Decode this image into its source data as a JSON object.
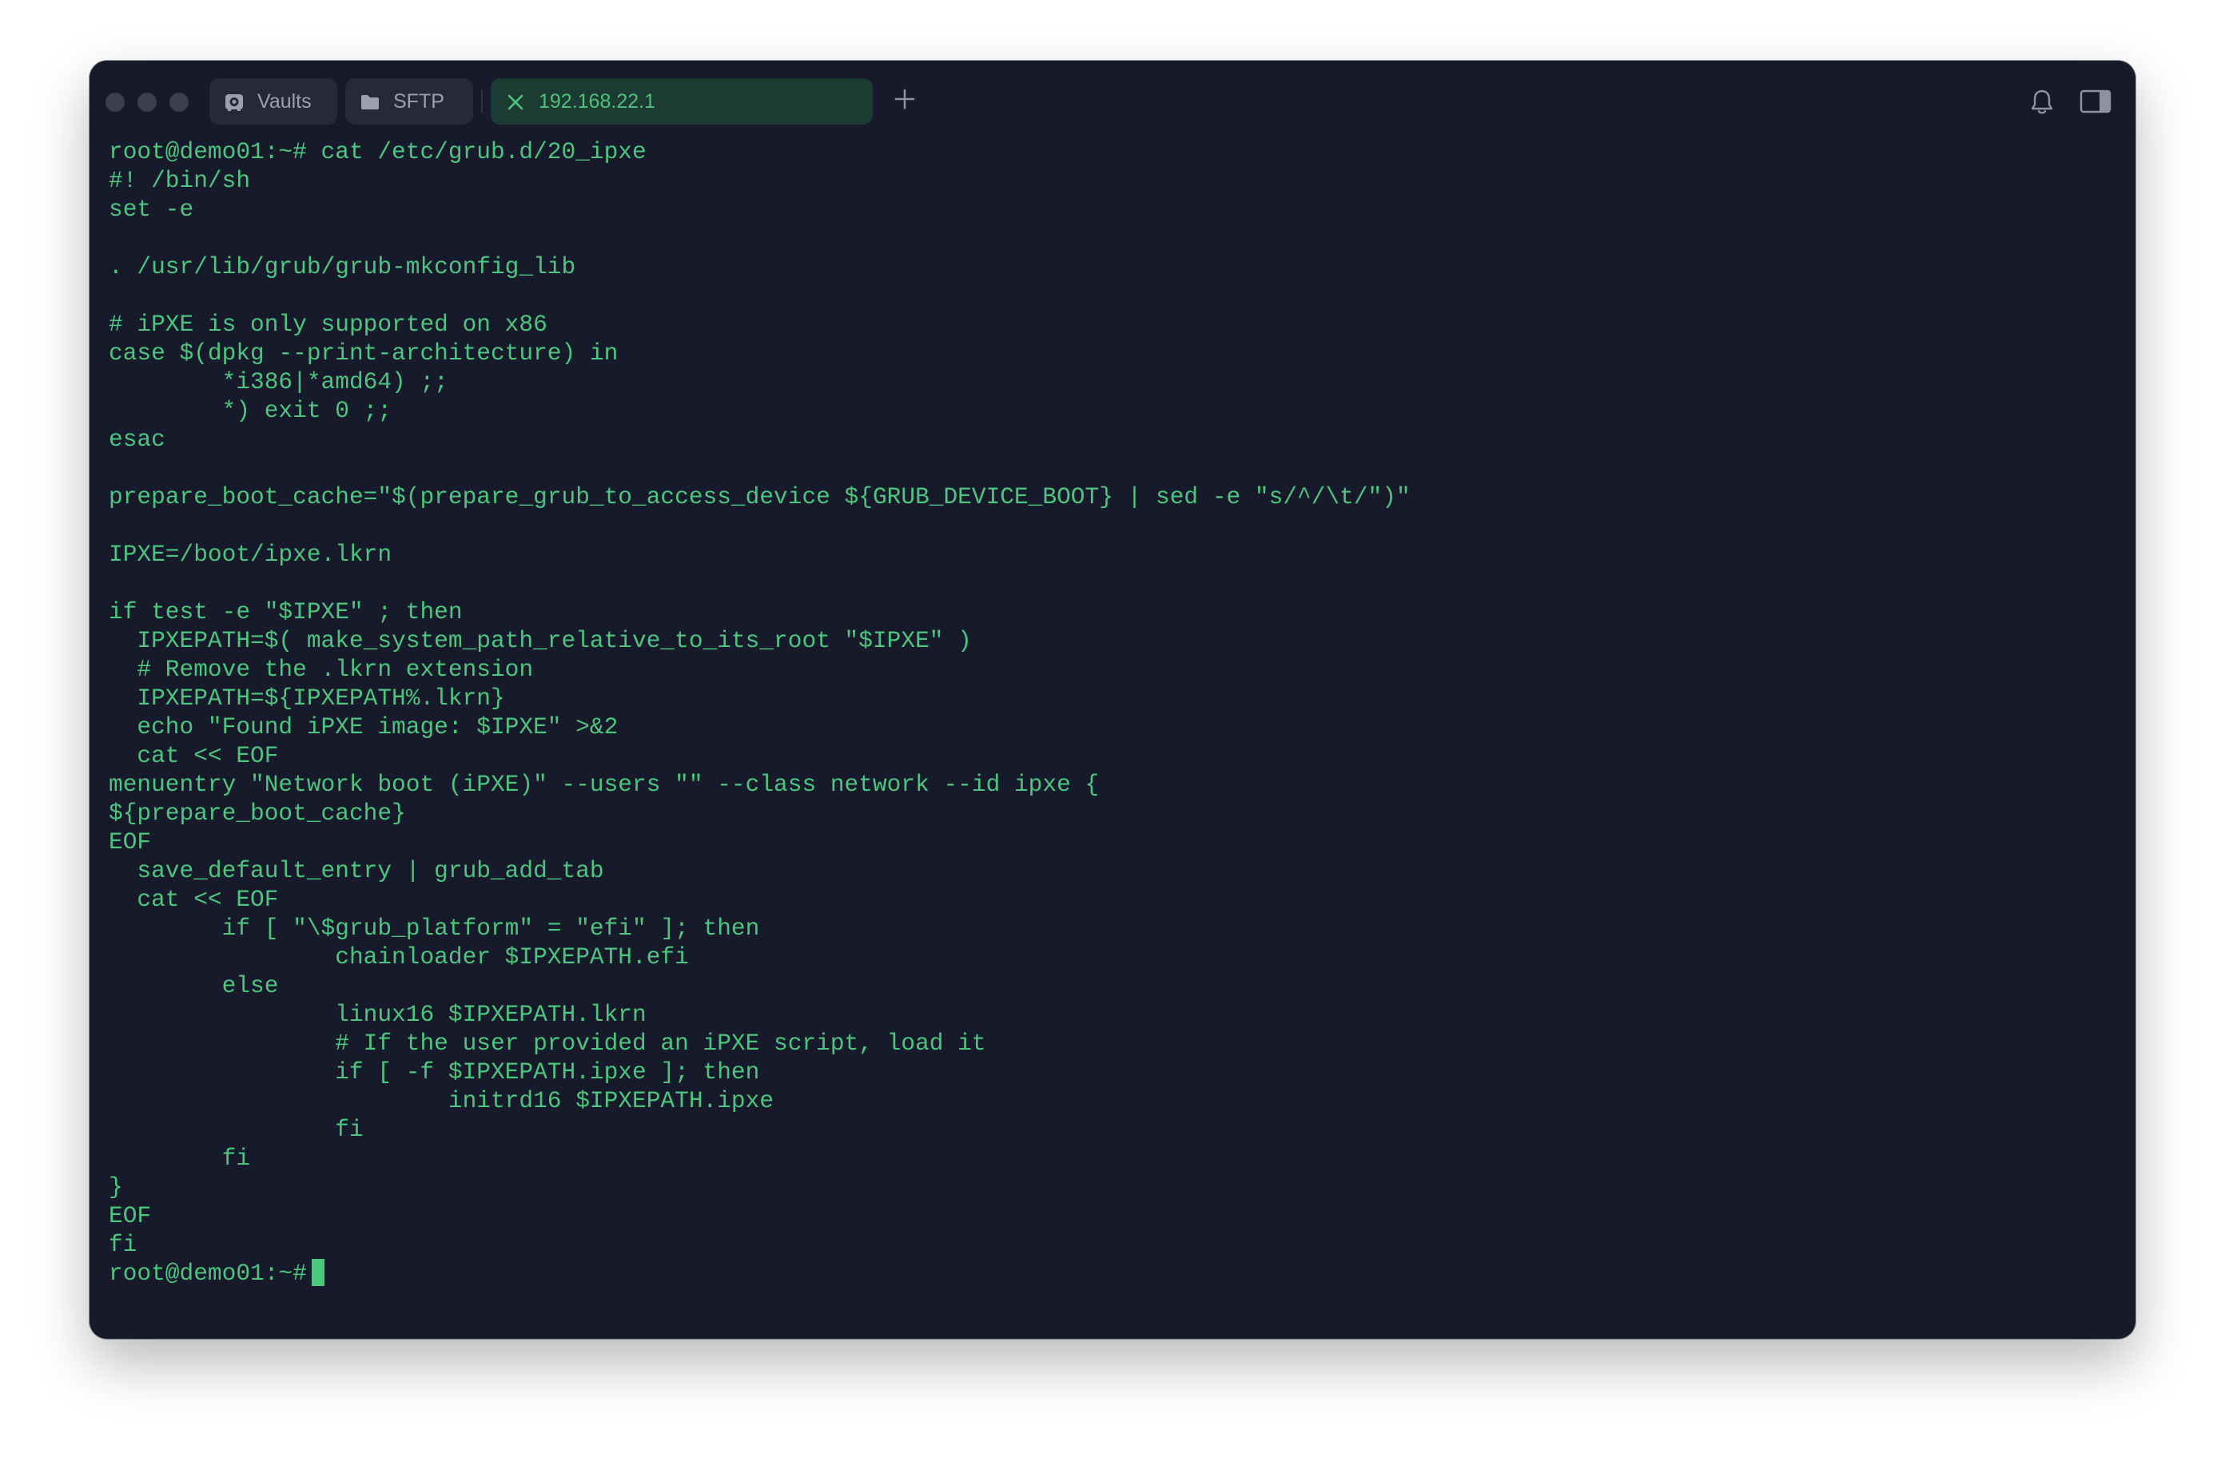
{
  "window": {
    "tabs": [
      {
        "label": "Vaults",
        "icon": "vault-icon"
      },
      {
        "label": "SFTP",
        "icon": "folder-icon"
      },
      {
        "label": "192.168.22.1",
        "icon": "close-icon",
        "active": true
      }
    ],
    "new_tab_icon": "plus-icon",
    "notifications_icon": "bell-icon",
    "sidebar_icon": "sidebar-toggle-icon"
  },
  "colors": {
    "background": "#161a2b",
    "terminal_text": "#4cc57e",
    "active_tab": "#1c3b32",
    "inactive_tab": "#252938"
  },
  "terminal": {
    "lines": [
      "root@demo01:~# cat /etc/grub.d/20_ipxe",
      "#! /bin/sh",
      "set -e",
      "",
      ". /usr/lib/grub/grub-mkconfig_lib",
      "",
      "# iPXE is only supported on x86",
      "case $(dpkg --print-architecture) in",
      "        *i386|*amd64) ;;",
      "        *) exit 0 ;;",
      "esac",
      "",
      "prepare_boot_cache=\"$(prepare_grub_to_access_device ${GRUB_DEVICE_BOOT} | sed -e \"s/^/\\t/\")\"",
      "",
      "IPXE=/boot/ipxe.lkrn",
      "",
      "if test -e \"$IPXE\" ; then",
      "  IPXEPATH=$( make_system_path_relative_to_its_root \"$IPXE\" )",
      "  # Remove the .lkrn extension",
      "  IPXEPATH=${IPXEPATH%.lkrn}",
      "  echo \"Found iPXE image: $IPXE\" >&2",
      "  cat << EOF",
      "menuentry \"Network boot (iPXE)\" --users \"\" --class network --id ipxe {",
      "${prepare_boot_cache}",
      "EOF",
      "  save_default_entry | grub_add_tab",
      "  cat << EOF",
      "        if [ \"\\$grub_platform\" = \"efi\" ]; then",
      "                chainloader $IPXEPATH.efi",
      "        else",
      "                linux16 $IPXEPATH.lkrn",
      "                # If the user provided an iPXE script, load it",
      "                if [ -f $IPXEPATH.ipxe ]; then",
      "                        initrd16 $IPXEPATH.ipxe",
      "                fi",
      "        fi",
      "}",
      "EOF",
      "fi"
    ],
    "prompt": "root@demo01:~# "
  }
}
